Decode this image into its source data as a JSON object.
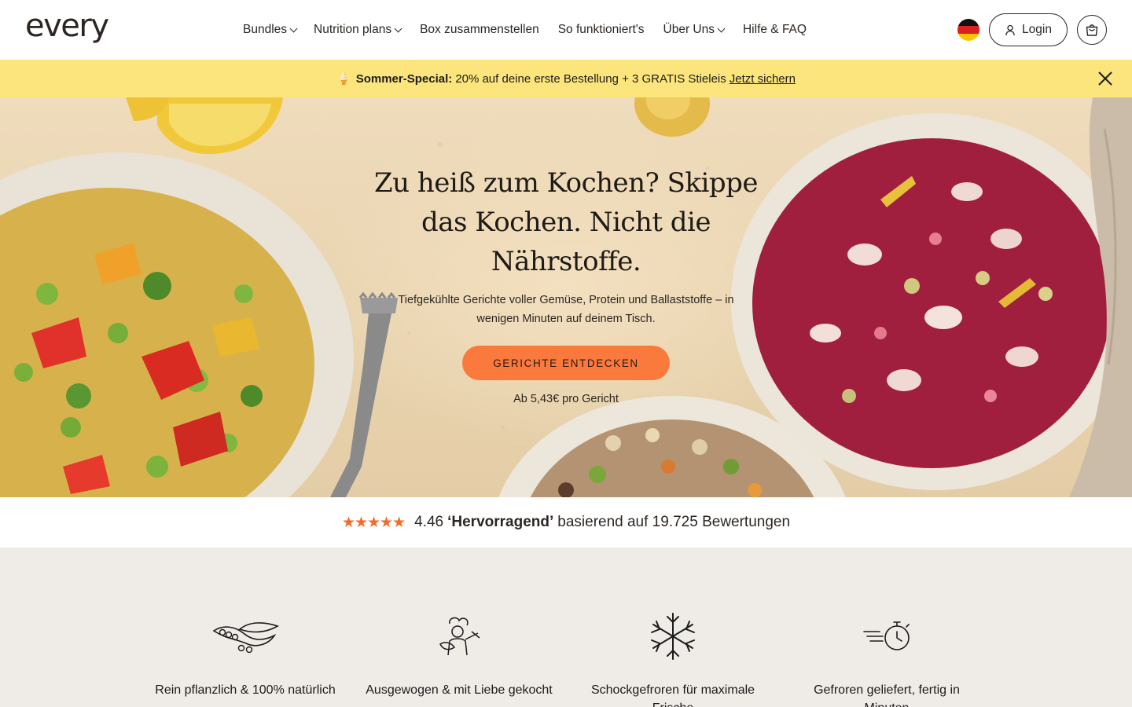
{
  "header": {
    "logo": "every",
    "nav": [
      {
        "label": "Bundles",
        "dropdown": true
      },
      {
        "label": "Nutrition plans",
        "dropdown": true
      },
      {
        "label": "Box zusammenstellen",
        "dropdown": false
      },
      {
        "label": "So funktioniert's",
        "dropdown": false
      },
      {
        "label": "Über Uns",
        "dropdown": true
      },
      {
        "label": "Hilfe & FAQ",
        "dropdown": false
      }
    ],
    "flag_icon": "germany-flag-icon",
    "login_label": "Login",
    "cart_icon": "shopping-bag-icon"
  },
  "promo": {
    "icon": "ice-cream-icon",
    "strong": "Sommer-Special:",
    "text": "20% auf deine erste Bestellung + 3 GRATIS Stieleis",
    "link": "Jetzt sichern",
    "color": "#fbe57c"
  },
  "hero": {
    "title": "Zu heiß zum Kochen? Skippe das Kochen. Nicht die Nährstoffe.",
    "subtitle": "Tiefgekühlte Gerichte voller Gemüse, Protein und Ballaststoffe – in wenigen Minuten auf deinem Tisch.",
    "cta": "GERICHTE ENTDECKEN",
    "price_note": "Ab 5,43€ pro Gericht",
    "cta_color": "#f97a3c"
  },
  "rating": {
    "stars": "★★★★★",
    "score": "4.46",
    "verdict": "‘Hervorragend’",
    "text": "basierend auf 19.725 Bewertungen",
    "star_color": "#f26b2b"
  },
  "features": [
    {
      "icon": "peas-pod-icon",
      "label": "Rein pflanzlich & 100% natürlich"
    },
    {
      "icon": "chef-icon",
      "label": "Ausgewogen & mit Liebe gekocht"
    },
    {
      "icon": "snowflake-icon",
      "label": "Schockgefroren für maximale Frische"
    },
    {
      "icon": "stopwatch-icon",
      "label": "Gefroren geliefert, fertig in Minuten"
    }
  ]
}
